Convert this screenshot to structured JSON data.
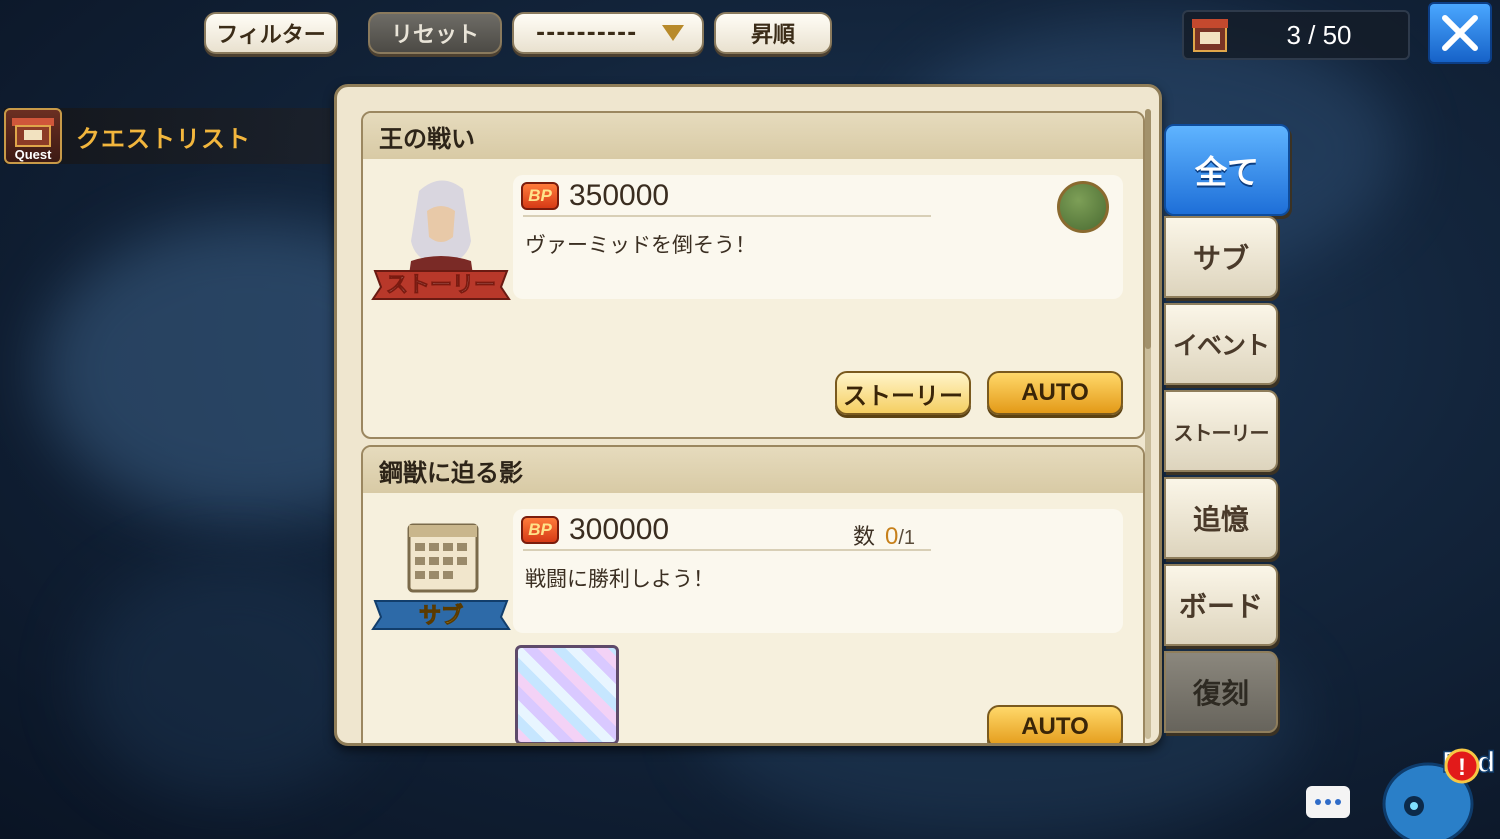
{
  "toolbar": {
    "filter_label": "フィルター",
    "reset_label": "リセット",
    "sort_select_value": "----------",
    "order_label": "昇順"
  },
  "counter": {
    "value": "3 / 50"
  },
  "quest_list": {
    "icon_label": "Quest",
    "title": "クエストリスト"
  },
  "quests": [
    {
      "title": "王の戦い",
      "type_badge": "ストーリー",
      "bp": "350000",
      "description": "ヴァーミッドを倒そう！",
      "buttons": {
        "story": "ストーリー",
        "auto": "AUTO"
      }
    },
    {
      "title": "鋼獣に迫る影",
      "type_badge": "サブ",
      "bp": "300000",
      "count_label": "数",
      "count_current": "0",
      "count_max": "/1",
      "description": "戦闘に勝利しよう！",
      "buttons": {
        "auto": "AUTO"
      }
    }
  ],
  "tabs": [
    "全て",
    "サブ",
    "イベント",
    "ストーリー",
    "追憶",
    "ボード",
    "復刻"
  ],
  "find_button": {
    "label": "Fi d"
  },
  "colors": {
    "accent_blue": "#1e6fd8",
    "gold": "#e39a18",
    "panel_bg": "#efe6cf"
  }
}
